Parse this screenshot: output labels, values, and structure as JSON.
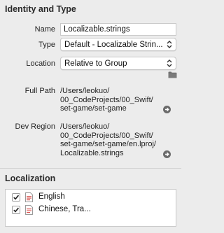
{
  "identity": {
    "section_title": "Identity and Type",
    "name_label": "Name",
    "name_value": "Localizable.strings",
    "type_label": "Type",
    "type_value": "Default - Localizable Strin...",
    "location_label": "Location",
    "location_value": "Relative to Group",
    "full_path_label": "Full Path",
    "full_path_lines": [
      "/Users/leokuo/",
      "00_CodeProjects/00_Swift/",
      "set-game/set-game"
    ],
    "dev_region_label": "Dev Region",
    "dev_region_lines": [
      "/Users/leokuo/",
      "00_CodeProjects/00_Swift/",
      "set-game/set-game/en.lproj/",
      "Localizable.strings"
    ]
  },
  "localization": {
    "section_title": "Localization",
    "items": [
      {
        "label": "English",
        "checked": true
      },
      {
        "label": "Chinese, Tra...",
        "checked": true
      }
    ]
  },
  "icons": {
    "folder": "folder-icon",
    "reveal": "arrow-right-circle-icon",
    "popup_chevron": "up-down-chevron-icon",
    "file": "strings-file-icon",
    "checkmark": "checkmark-icon"
  },
  "colors": {
    "background": "#ececec",
    "field_background": "#ffffff",
    "file_icon_accent": "#d9534f"
  }
}
